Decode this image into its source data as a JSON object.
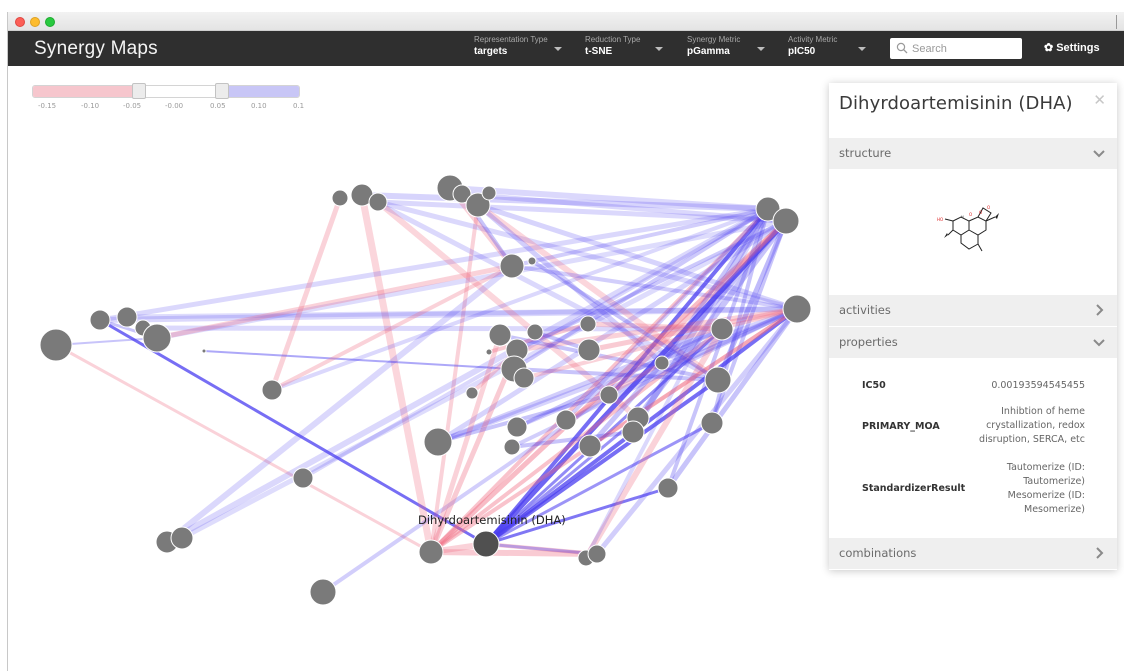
{
  "app": {
    "title": "Synergy Maps"
  },
  "toolbar": {
    "dropdowns": [
      {
        "label": "Representation Type",
        "value": "targets"
      },
      {
        "label": "Reduction Type",
        "value": "t-SNE"
      },
      {
        "label": "Synergy Metric",
        "value": "pGamma"
      },
      {
        "label": "Activity Metric",
        "value": "pIC50"
      }
    ],
    "search_placeholder": "Search",
    "settings_label": "Settings"
  },
  "slider": {
    "ticks": [
      "-0.15",
      "-0.10",
      "-0.05",
      "-0.00",
      "0.05",
      "0.10",
      "0.1"
    ],
    "range_low": -0.05,
    "range_high": 0.05,
    "colors": {
      "negative": "#f6c6cd",
      "positive": "#c8c6f6"
    }
  },
  "graph": {
    "selected_label": "Dihyrdoartemisinin (DHA)",
    "colors": {
      "node": "#7a7a7a",
      "selected_node": "#505050",
      "synergy_pos": "#4a3df0",
      "synergy_neg": "#ef6a80"
    }
  },
  "panel": {
    "title": "Dihyrdoartemisinin (DHA)",
    "sections": {
      "structure": "structure",
      "activities": "activities",
      "properties": "properties",
      "combinations": "combinations"
    },
    "properties": [
      {
        "key": "IC50",
        "value": "0.00193594545455"
      },
      {
        "key": "PRIMARY_MOA",
        "value": "Inhibtion of heme crystallization, redox disruption, SERCA, etc"
      },
      {
        "key": "StandardizerResult",
        "value": "Tautomerize (ID: Tautomerize) Mesomerize (ID: Mesomerize)"
      }
    ]
  }
}
